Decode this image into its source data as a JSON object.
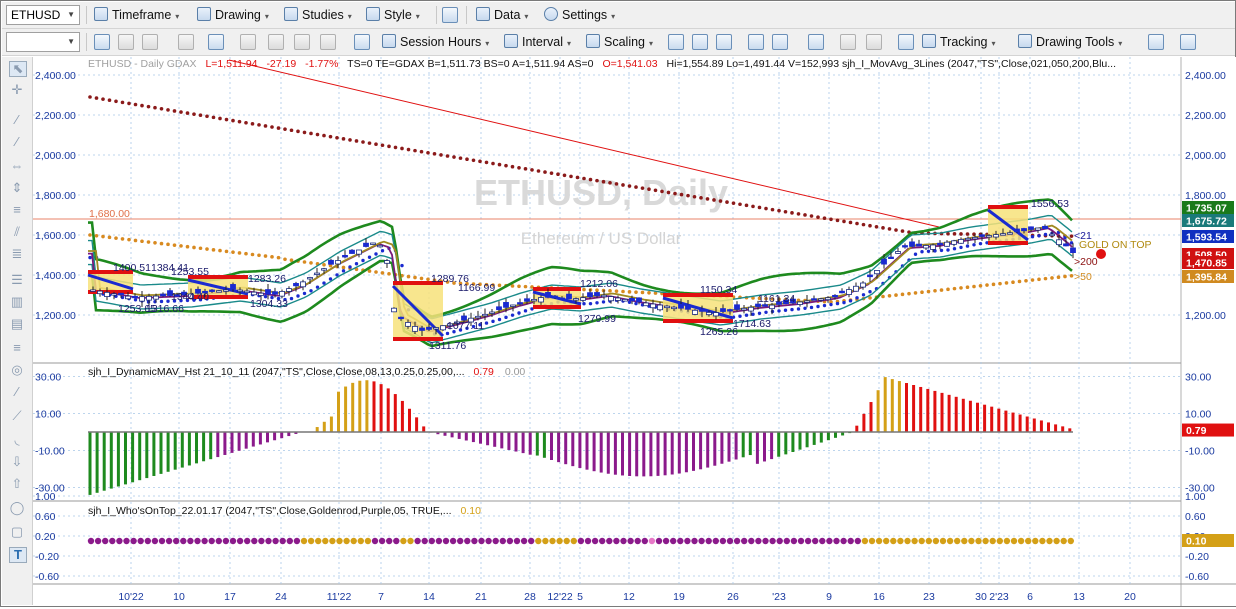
{
  "symbol": "ETHUSD",
  "toolbar1": {
    "timeframe": "Timeframe",
    "drawing": "Drawing",
    "studies": "Studies",
    "style": "Style",
    "data": "Data",
    "settings": "Settings"
  },
  "toolbar2": {
    "session_hours": "Session Hours",
    "interval": "Interval",
    "scaling": "Scaling",
    "tracking": "Tracking",
    "drawing_tools": "Drawing Tools"
  },
  "main_pane": {
    "header": {
      "name": "ETHUSD - Daily  GDAX",
      "last": "L=1,511.94",
      "change": "-27.19",
      "pct": "-1.77%",
      "rest1": "TS=0  TE=GDAX  B=1,511.73  BS=0  A=1,511.94  AS=0",
      "open": "O=1,541.03",
      "rest2": "Hi=1,554.89  Lo=1,491.44  V=152,993  sjh_I_MovAvg_3Lines (2047,\"TS\",Close,021,050,200,Blu..."
    },
    "watermark_title": "ETHUSD, Daily",
    "watermark_sub": "Ethereum / US Dollar",
    "hline_label": "1,680.00",
    "y_ticks": [
      "2,400.00",
      "2,200.00",
      "2,000.00",
      "1,800.00",
      "1,600.00",
      "1,400.00",
      "1,200.00"
    ],
    "price_tags": [
      {
        "text": "1,735.07",
        "color": "#1a7a1a"
      },
      {
        "text": "1,675.72",
        "color": "#1a7a7a"
      },
      {
        "text": "1,593.54",
        "color": "#1030c0"
      },
      {
        "text": "1,508.50",
        "color": "#d01010"
      },
      {
        "text": "1,470.85",
        "color": "#d01010"
      },
      {
        "text": "1,395.84",
        "color": "#d08a20"
      }
    ],
    "ma_labels": {
      "ma21": "<21",
      "ma200": ">200",
      "ma50": ">50"
    },
    "gold_on_top": "GOLD ON TOP",
    "annotations": [
      "1400.51",
      "1384.41",
      "1253.55",
      "1253.65",
      "1316.66",
      "1344.40",
      "1283.26",
      "1304.33",
      "1289.76",
      "1166.99",
      "1077.11",
      "1311.76",
      "1212.06",
      "1279.99",
      "1150.34",
      "1265.26",
      "1161.34",
      "1714.63",
      "1556.53"
    ]
  },
  "pane2": {
    "header": "sjh_I_DynamicMAV_Hst 21_10_11 (2047,\"TS\",Close,Close,08,13,0.25,0.25,00,...",
    "val1": "0.79",
    "val2": "0.00",
    "y_ticks": [
      "30.00",
      "10.00",
      "-10.00",
      "-30.00"
    ],
    "tag": "0.79"
  },
  "pane3": {
    "header": "sjh_I_Who'sOnTop_22.01.17 (2047,\"TS\",Close,Goldenrod,Purple,05, TRUE,...",
    "val": "0.10",
    "y_ticks": [
      "1.00",
      "0.60",
      "0.20",
      "-0.20",
      "-0.60"
    ],
    "tag": "0.10"
  },
  "x_labels": [
    "10'22",
    "10",
    "17",
    "24",
    "11'22",
    "7",
    "14",
    "21",
    "28",
    "12'22",
    "5",
    "12",
    "19",
    "26",
    "'23",
    "9",
    "16",
    "23",
    "30",
    "2'23",
    "6",
    "13",
    "20"
  ],
  "colors": {
    "accent": "#1a3aa0",
    "gold": "#d4a017",
    "purple": "#8b1a8b",
    "red": "#e01010",
    "green": "#2a8a2a"
  }
}
